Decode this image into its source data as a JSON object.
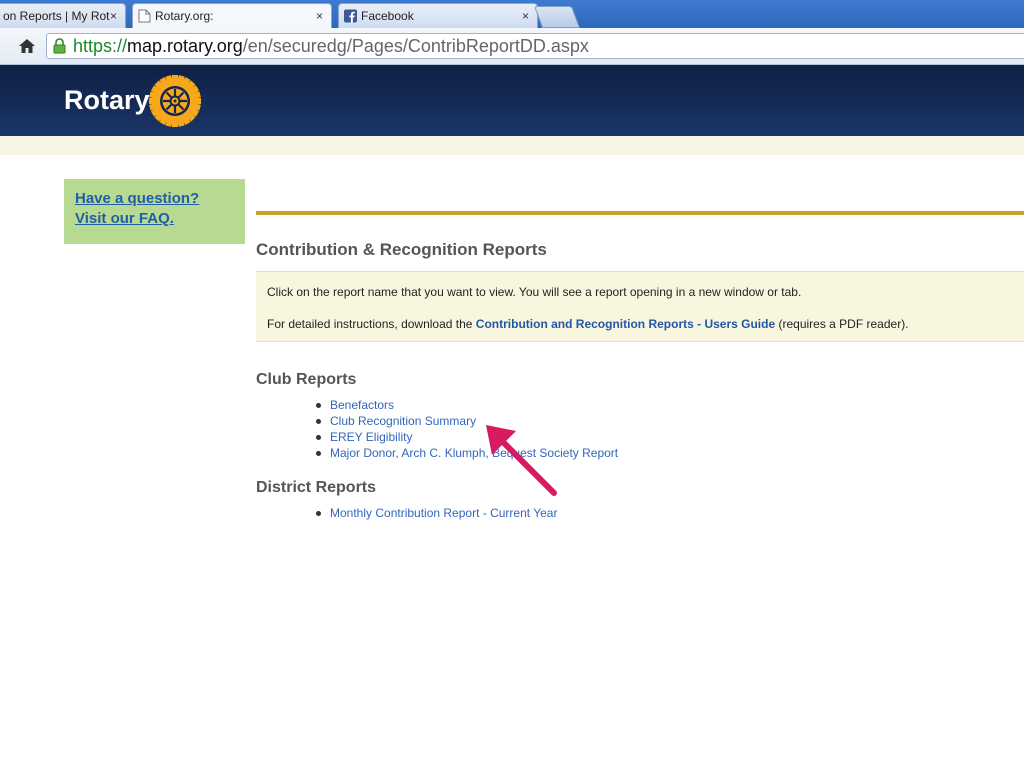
{
  "browser": {
    "tabs": [
      {
        "label": "on Reports | My Rot",
        "close": "×"
      },
      {
        "label": "Rotary.org:",
        "close": "×"
      },
      {
        "label": "Facebook",
        "close": "×"
      }
    ],
    "url": {
      "scheme": "https://",
      "host": "map.rotary.org",
      "path": "/en/securedg/Pages/ContribReportDD.aspx"
    }
  },
  "header": {
    "logo_text": "Rotary",
    "brand_color": "#f7a81b"
  },
  "sidebar": {
    "faq_line1": "Have a question?",
    "faq_line2": "Visit our FAQ."
  },
  "main": {
    "title": "Contribution & Recognition Reports",
    "info": {
      "line1": "Click on the report name that you want to view. You will see a report opening in a new window or tab.",
      "line2_prefix": "For detailed instructions, download the ",
      "line2_link": "Contribution and Recognition Reports - Users Guide",
      "line2_suffix": " (requires a PDF reader)."
    },
    "club_reports": {
      "title": "Club Reports",
      "items": [
        "Benefactors",
        "Club Recognition Summary",
        "EREY Eligibility",
        "Major Donor, Arch C. Klumph, Bequest Society Report"
      ]
    },
    "district_reports": {
      "title": "District Reports",
      "items": [
        "Monthly Contribution Report - Current Year"
      ]
    }
  },
  "annotation": {
    "arrow_color": "#d81b60"
  }
}
